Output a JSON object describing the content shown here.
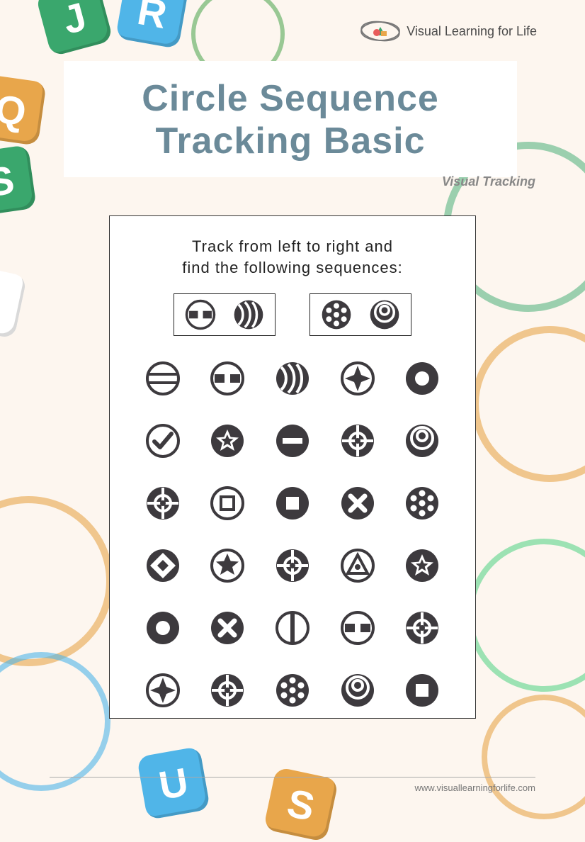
{
  "logo_text": "Visual Learning for Life",
  "title_line1": "Circle Sequence",
  "title_line2": "Tracking Basic",
  "subtitle": "Visual Tracking",
  "instruction_line1": "Track from left to right and",
  "instruction_line2": "find the following sequences:",
  "footer_url": "www.visuallearningforlife.com",
  "targets": [
    [
      "h-gap",
      "waves"
    ],
    [
      "dots6",
      "concentric"
    ]
  ],
  "grid": [
    [
      "h-lines",
      "h-gap",
      "waves",
      "star4-solid",
      "donut"
    ],
    [
      "check",
      "star5-solid",
      "minus-solid",
      "target-plus",
      "concentric"
    ],
    [
      "target-plus",
      "square-outline",
      "square-solid",
      "x-solid",
      "dots6"
    ],
    [
      "diamond-gap",
      "star5-outline",
      "target-plus",
      "triangle",
      "star5-solid"
    ],
    [
      "donut",
      "x-solid",
      "v-line",
      "h-gap",
      "target-plus"
    ],
    [
      "star4-solid",
      "target-plus",
      "dots6",
      "concentric",
      "square-solid"
    ]
  ],
  "colors": {
    "dark": "#3d3a3e",
    "title": "#6b8a99"
  }
}
